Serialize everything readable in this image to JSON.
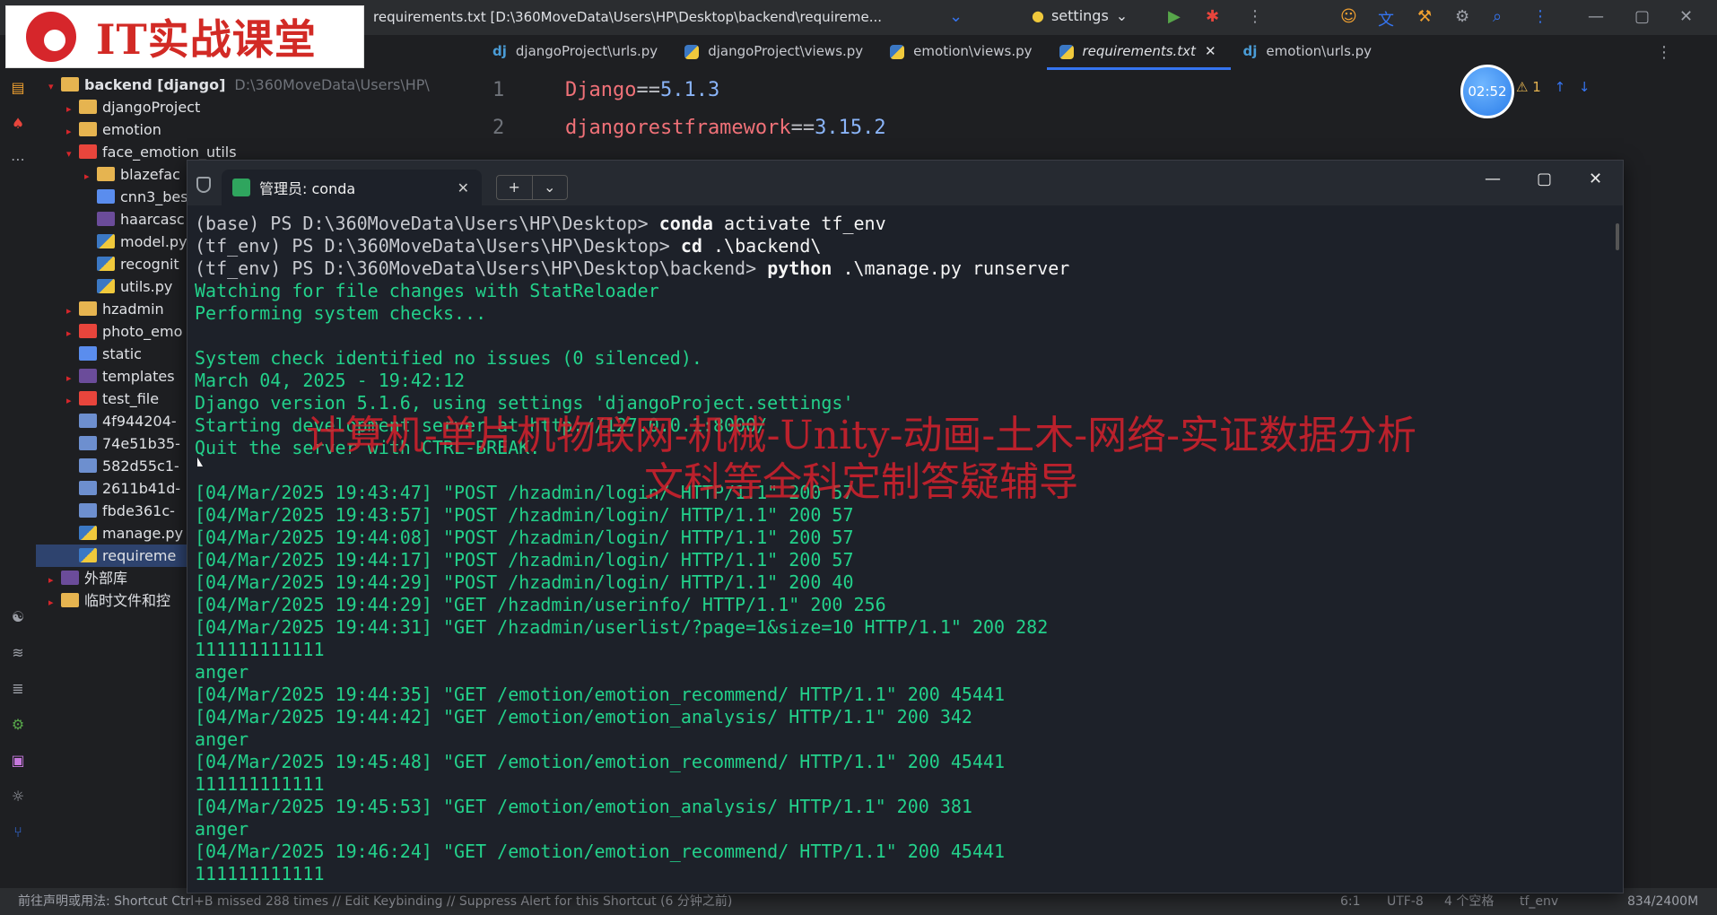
{
  "logo": {
    "text": "IT实战课堂"
  },
  "titlebar": {
    "project_path": "requirements.txt [D:\\360MoveData\\Users\\HP\\Desktop\\backend\\requireme...",
    "run_config": "settings"
  },
  "project_tree": [
    {
      "label": "backend [django]",
      "muted": "D:\\360MoveData\\Users\\HP\\",
      "icon": "folder-icon",
      "arrow": "▾",
      "indent": 0
    },
    {
      "label": "djangoProject",
      "icon": "folder-icon",
      "arrow": "▸",
      "indent": 1
    },
    {
      "label": "emotion",
      "icon": "folder-icon",
      "arrow": "▸",
      "indent": 1
    },
    {
      "label": "face_emotion_utils",
      "icon": "folder-icon",
      "arrow": "▾",
      "indent": 1
    },
    {
      "label": "blazefac",
      "icon": "folder-icon",
      "arrow": "▸",
      "indent": 2
    },
    {
      "label": "cnn3_bes",
      "icon": "asterisk-icon",
      "arrow": "",
      "indent": 2
    },
    {
      "label": "haarcasc",
      "icon": "xml-icon",
      "arrow": "",
      "indent": 2
    },
    {
      "label": "model.py",
      "icon": "python-icon",
      "arrow": "",
      "indent": 2
    },
    {
      "label": "recognit",
      "icon": "python-icon",
      "arrow": "",
      "indent": 2
    },
    {
      "label": "utils.py",
      "icon": "python-icon",
      "arrow": "",
      "indent": 2
    },
    {
      "label": "hzadmin",
      "icon": "folder-icon",
      "arrow": "▸",
      "indent": 1
    },
    {
      "label": "photo_emo",
      "icon": "folder-icon",
      "arrow": "▸",
      "indent": 1
    },
    {
      "label": "static",
      "icon": "folder-icon",
      "arrow": "",
      "indent": 1
    },
    {
      "label": "templates",
      "icon": "folder-icon",
      "arrow": "▸",
      "indent": 1
    },
    {
      "label": "test_file",
      "icon": "folder-icon",
      "arrow": "▸",
      "indent": 1
    },
    {
      "label": "4f944204-",
      "icon": "image-icon",
      "arrow": "",
      "indent": 1
    },
    {
      "label": "74e51b35-",
      "icon": "image-icon",
      "arrow": "",
      "indent": 1
    },
    {
      "label": "582d55c1-",
      "icon": "image-icon",
      "arrow": "",
      "indent": 1
    },
    {
      "label": "2611b41d-",
      "icon": "image-icon",
      "arrow": "",
      "indent": 1
    },
    {
      "label": "fbde361c-",
      "icon": "image-icon",
      "arrow": "",
      "indent": 1
    },
    {
      "label": "manage.py",
      "icon": "python-icon",
      "arrow": "",
      "indent": 1
    },
    {
      "label": "requireme",
      "icon": "python-icon",
      "arrow": "",
      "indent": 1
    },
    {
      "label": "外部库",
      "icon": "library-icon",
      "arrow": "▸",
      "indent": 0
    },
    {
      "label": "临时文件和控",
      "icon": "scratch-icon",
      "arrow": "▸",
      "indent": 0
    }
  ],
  "tabs": [
    {
      "label": "djangoProject\\urls.py",
      "icon": "dj"
    },
    {
      "label": "djangoProject\\views.py",
      "icon": "py"
    },
    {
      "label": "emotion\\views.py",
      "icon": "py"
    },
    {
      "label": "requirements.txt",
      "icon": "py",
      "active": true
    },
    {
      "label": "emotion\\urls.py",
      "icon": "dj"
    }
  ],
  "editor": {
    "lines": [
      {
        "num": "1",
        "pkg": "Django",
        "op": "==",
        "ver": "5.1.3"
      },
      {
        "num": "2",
        "pkg": "djangorestframework",
        "op": "==",
        "ver": "3.15.2"
      }
    ],
    "timer": "02:52",
    "warnings": "1"
  },
  "terminal": {
    "tab_title": "管理员: conda",
    "lines": [
      {
        "prompt": "(base) PS D:\\360MoveData\\Users\\HP\\Desktop> ",
        "cmd": "conda",
        "arg": " activate tf_env"
      },
      {
        "prompt": "(tf_env) PS D:\\360MoveData\\Users\\HP\\Desktop> ",
        "cmd": "cd",
        "arg": " .\\backend\\"
      },
      {
        "prompt": "(tf_env) PS D:\\360MoveData\\Users\\HP\\Desktop\\backend> ",
        "cmd": "python",
        "arg": " .\\manage.py runserver"
      },
      {
        "text": "Watching for file changes with StatReloader"
      },
      {
        "text": "Performing system checks..."
      },
      {
        "text": ""
      },
      {
        "text": "System check identified no issues (0 silenced)."
      },
      {
        "text": "March 04, 2025 - 19:42:12"
      },
      {
        "text": "Django version 5.1.6, using settings 'djangoProject.settings'"
      },
      {
        "text": "Starting development server at http://127.0.0.1:8000/"
      },
      {
        "text": "Quit the server with CTRL-BREAK."
      },
      {
        "text": ""
      },
      {
        "text": "[04/Mar/2025 19:43:47] \"POST /hzadmin/login/ HTTP/1.1\" 200 57"
      },
      {
        "text": "[04/Mar/2025 19:43:57] \"POST /hzadmin/login/ HTTP/1.1\" 200 57"
      },
      {
        "text": "[04/Mar/2025 19:44:08] \"POST /hzadmin/login/ HTTP/1.1\" 200 57"
      },
      {
        "text": "[04/Mar/2025 19:44:17] \"POST /hzadmin/login/ HTTP/1.1\" 200 57"
      },
      {
        "text": "[04/Mar/2025 19:44:29] \"POST /hzadmin/login/ HTTP/1.1\" 200 40"
      },
      {
        "text": "[04/Mar/2025 19:44:29] \"GET /hzadmin/userinfo/ HTTP/1.1\" 200 256"
      },
      {
        "text": "[04/Mar/2025 19:44:31] \"GET /hzadmin/userlist/?page=1&size=10 HTTP/1.1\" 200 282"
      },
      {
        "text": "111111111111"
      },
      {
        "text": "anger"
      },
      {
        "text": "[04/Mar/2025 19:44:35] \"GET /emotion/emotion_recommend/ HTTP/1.1\" 200 45441"
      },
      {
        "text": "[04/Mar/2025 19:44:42] \"GET /emotion/emotion_analysis/ HTTP/1.1\" 200 342"
      },
      {
        "text": "anger"
      },
      {
        "text": "[04/Mar/2025 19:45:48] \"GET /emotion/emotion_recommend/ HTTP/1.1\" 200 45441"
      },
      {
        "text": "111111111111"
      },
      {
        "text": "[04/Mar/2025 19:45:53] \"GET /emotion/emotion_analysis/ HTTP/1.1\" 200 381"
      },
      {
        "text": "anger"
      },
      {
        "text": "[04/Mar/2025 19:46:24] \"GET /emotion/emotion_recommend/ HTTP/1.1\" 200 45441"
      },
      {
        "text": "111111111111"
      }
    ]
  },
  "watermark": {
    "line1": "计算机-单片机物联网-机械-Unity-动画-土木-网络-实证数据分析",
    "line2": "文科等全科定制答疑辅导"
  },
  "statusbar": {
    "left": "前往声明或用法: Shortcut  Ctrl+B  missed 288 times // Edit Keybinding // Suppress Alert for this Shortcut (6 分钟之前)",
    "position": "6:1",
    "encoding": "UTF-8",
    "indent": "4 个空格",
    "interpreter": "tf_env",
    "memory": "834/2400M"
  }
}
